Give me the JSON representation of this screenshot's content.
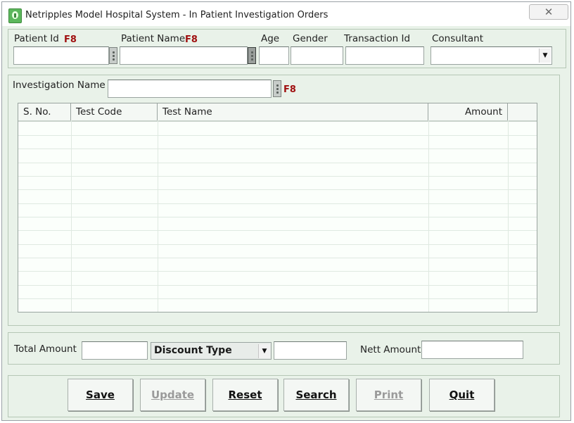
{
  "window": {
    "title": "Netripples Model Hospital System - In Patient Investigation Orders",
    "close_glyph": "✕",
    "icon": "app-icon"
  },
  "patient": {
    "patient_id_label": "Patient Id",
    "patient_id_hotkey": "F8",
    "patient_id_value": "",
    "patient_name_label": "Patient Name",
    "patient_name_hotkey": "F8",
    "patient_name_value": "",
    "age_label": "Age",
    "age_value": "",
    "gender_label": "Gender",
    "gender_value": "",
    "transaction_label": "Transaction Id",
    "transaction_value": "",
    "consultant_label": "Consultant",
    "consultant_value": ""
  },
  "investigation": {
    "label": "Investigation Name",
    "value": "",
    "hotkey": "F8"
  },
  "table": {
    "columns": [
      "S. No.",
      "Test Code",
      "Test Name",
      "Amount",
      ""
    ],
    "rows": []
  },
  "totals": {
    "total_label": "Total Amount",
    "total_value": "",
    "discount_type": "Discount Type",
    "discount_value": "",
    "nett_label": "Nett Amount",
    "nett_value": ""
  },
  "buttons": {
    "save": "Save",
    "update": "Update",
    "reset": "Reset",
    "search": "Search",
    "print": "Print",
    "quit": "Quit"
  },
  "colors": {
    "background": "#e9f2e9",
    "hotkey": "#a01010"
  }
}
